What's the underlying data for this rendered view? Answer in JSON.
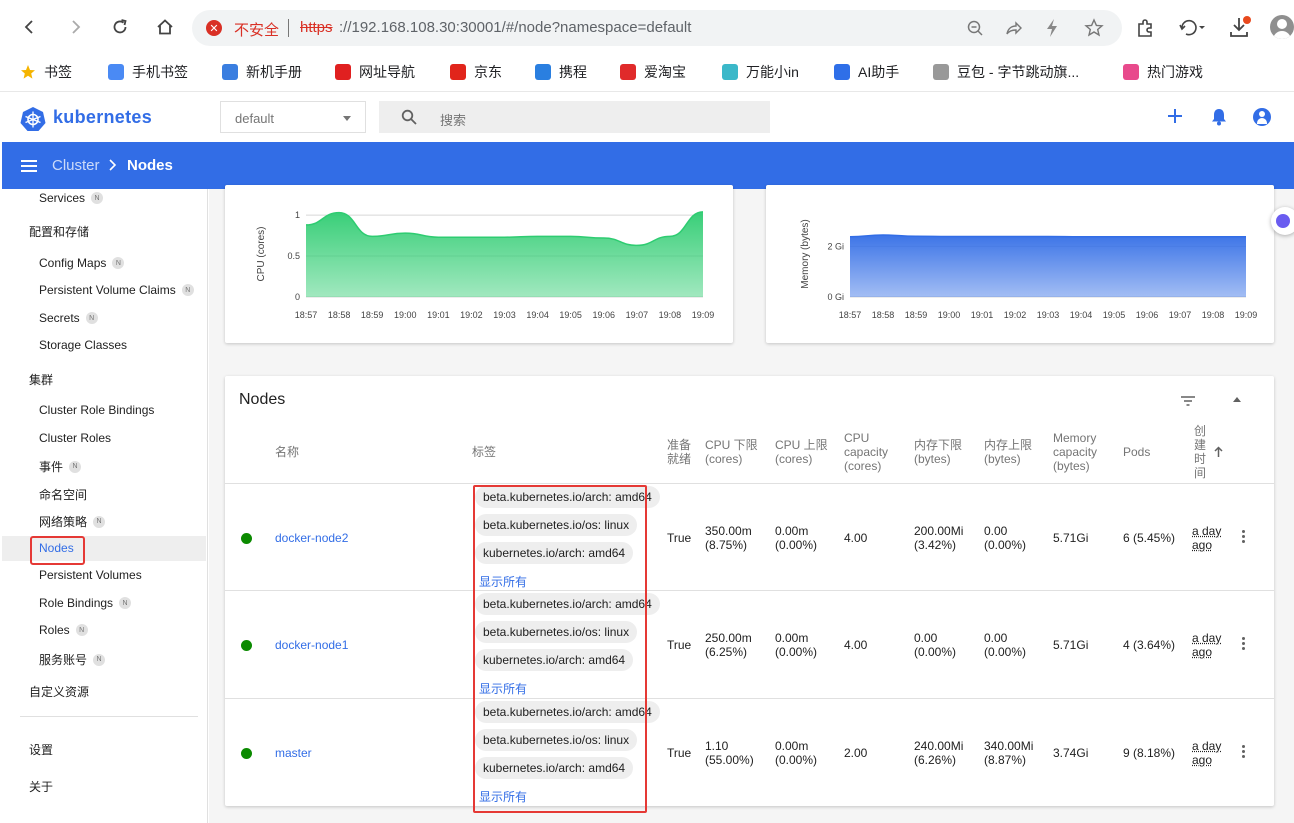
{
  "browser": {
    "security_label": "不安全",
    "url_scheme": "https",
    "url_rest": "://192.168.108.30:30001/#/node?namespace=default",
    "bookmarks": [
      {
        "label": "书签",
        "color": "#f5b400"
      },
      {
        "label": "手机书签",
        "color": "#4a8af4"
      },
      {
        "label": "新机手册",
        "color": "#3a7ee0"
      },
      {
        "label": "网址导航",
        "color": "#e02020"
      },
      {
        "label": "京东",
        "color": "#e1251b"
      },
      {
        "label": "携程",
        "color": "#2a7fe0"
      },
      {
        "label": "爱淘宝",
        "color": "#e02a2a"
      },
      {
        "label": "万能小in",
        "color": "#3bb8c9"
      },
      {
        "label": "AI助手",
        "color": "#2f6fe8"
      },
      {
        "label": "豆包 - 字节跳动旗...",
        "color": "#999999"
      },
      {
        "label": "热门游戏",
        "color": "#e84a8c"
      }
    ]
  },
  "app": {
    "logo_text": "kubernetes",
    "namespace_value": "default",
    "search_placeholder": "搜索",
    "breadcrumb_root": "Cluster",
    "breadcrumb_current": "Nodes",
    "accent": "#326de6"
  },
  "sidebar": {
    "services": "Services",
    "section_config": "配置和存储",
    "config_maps": "Config Maps",
    "pvc": "Persistent Volume Claims",
    "secrets": "Secrets",
    "storage_classes": "Storage Classes",
    "section_cluster": "集群",
    "cluster_role_bindings": "Cluster Role Bindings",
    "cluster_roles": "Cluster Roles",
    "events": "事件",
    "namespaces": "命名空间",
    "network_policies": "网络策略",
    "nodes": "Nodes",
    "pv": "Persistent Volumes",
    "role_bindings": "Role Bindings",
    "roles": "Roles",
    "service_accounts": "服务账号",
    "custom_resources": "自定义资源",
    "settings": "设置",
    "about": "关于",
    "badge": "N"
  },
  "chart_data": [
    {
      "type": "area",
      "ylabel": "CPU (cores)",
      "x": [
        "18:57",
        "18:58",
        "18:59",
        "19:00",
        "19:01",
        "19:02",
        "19:03",
        "19:04",
        "19:05",
        "19:06",
        "19:07",
        "19:08",
        "19:09"
      ],
      "ytick_labels": [
        "0",
        "0.5",
        "1"
      ],
      "ylim": [
        0,
        1.05
      ],
      "values": [
        0.88,
        1.03,
        0.74,
        0.78,
        0.73,
        0.73,
        0.73,
        0.74,
        0.74,
        0.72,
        0.63,
        0.74,
        1.04
      ],
      "color": "#2ecc71"
    },
    {
      "type": "area",
      "ylabel": "Memory (bytes)",
      "x": [
        "18:57",
        "18:58",
        "18:59",
        "19:00",
        "19:01",
        "19:02",
        "19:03",
        "19:04",
        "19:05",
        "19:06",
        "19:07",
        "19:08",
        "19:09"
      ],
      "ytick_labels": [
        "0 Gi",
        "2 Gi"
      ],
      "ytick_values": [
        0,
        2
      ],
      "ylim": [
        0,
        3.4
      ],
      "values": [
        2.38,
        2.45,
        2.4,
        2.39,
        2.39,
        2.39,
        2.39,
        2.38,
        2.38,
        2.38,
        2.38,
        2.38,
        2.38
      ],
      "color": "#326de6"
    }
  ],
  "nodes": {
    "title": "Nodes",
    "headers": {
      "name": "名称",
      "labels": "标签",
      "ready": "准备就绪",
      "cpu_req": "CPU 下限 (cores)",
      "cpu_lim": "CPU 上限 (cores)",
      "cpu_cap": "CPU capacity (cores)",
      "mem_req": "内存下限 (bytes)",
      "mem_lim": "内存上限 (bytes)",
      "mem_cap": "Memory capacity (bytes)",
      "pods": "Pods",
      "created": "创建时间"
    },
    "show_all": "显示所有",
    "rows": [
      {
        "name": "docker-node2",
        "labels": [
          "beta.kubernetes.io/arch: amd64",
          "beta.kubernetes.io/os: linux",
          "kubernetes.io/arch: amd64"
        ],
        "ready": "True",
        "cpu_req_1": "350.00m",
        "cpu_req_2": "(8.75%)",
        "cpu_lim_1": "0.00m",
        "cpu_lim_2": "(0.00%)",
        "cpu_cap": "4.00",
        "mem_req_1": "200.00Mi",
        "mem_req_2": "(3.42%)",
        "mem_lim_1": "0.00",
        "mem_lim_2": "(0.00%)",
        "mem_cap": "5.71Gi",
        "pods": "6 (5.45%)",
        "age_1": "a day",
        "age_2": "ago"
      },
      {
        "name": "docker-node1",
        "labels": [
          "beta.kubernetes.io/arch: amd64",
          "beta.kubernetes.io/os: linux",
          "kubernetes.io/arch: amd64"
        ],
        "ready": "True",
        "cpu_req_1": "250.00m",
        "cpu_req_2": "(6.25%)",
        "cpu_lim_1": "0.00m",
        "cpu_lim_2": "(0.00%)",
        "cpu_cap": "4.00",
        "mem_req_1": "0.00",
        "mem_req_2": "(0.00%)",
        "mem_lim_1": "0.00",
        "mem_lim_2": "(0.00%)",
        "mem_cap": "5.71Gi",
        "pods": "4 (3.64%)",
        "age_1": "a day",
        "age_2": "ago"
      },
      {
        "name": "master",
        "labels": [
          "beta.kubernetes.io/arch: amd64",
          "beta.kubernetes.io/os: linux",
          "kubernetes.io/arch: amd64"
        ],
        "ready": "True",
        "cpu_req_1": "1.10",
        "cpu_req_2": "(55.00%)",
        "cpu_lim_1": "0.00m",
        "cpu_lim_2": "(0.00%)",
        "cpu_cap": "2.00",
        "mem_req_1": "240.00Mi",
        "mem_req_2": "(6.26%)",
        "mem_lim_1": "340.00Mi",
        "mem_lim_2": "(8.87%)",
        "mem_cap": "3.74Gi",
        "pods": "9 (8.18%)",
        "age_1": "a day",
        "age_2": "ago"
      }
    ]
  }
}
